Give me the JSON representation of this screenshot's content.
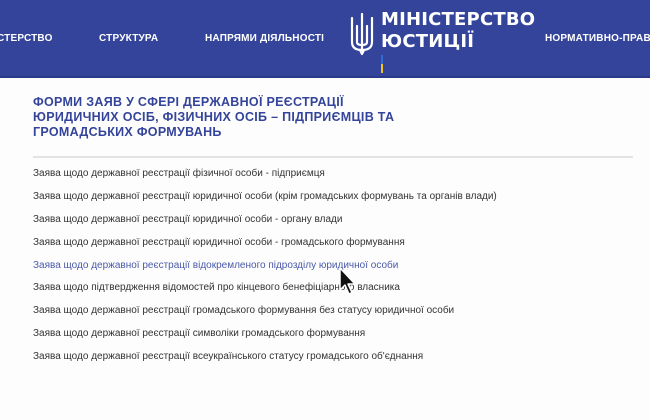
{
  "header": {
    "nav": [
      {
        "label": "ІСТЕРСТВО"
      },
      {
        "label": "СТРУКТУРА"
      },
      {
        "label": "НАПРЯМИ ДІЯЛЬНОСТІ"
      },
      {
        "label": "НОРМАТИВНО-ПРАВОВ"
      }
    ],
    "logo": {
      "line1": "МІНІСТЕРСТВО",
      "line2": "ЮСТИЦІЇ"
    }
  },
  "main": {
    "title": "ФОРМИ ЗАЯВ У СФЕРІ ДЕРЖАВНОЇ РЕЄСТРАЦІЇ ЮРИДИЧНИХ ОСІБ, ФІЗИЧНИХ ОСІБ – ПІДПРИЄМЦІВ ТА ГРОМАДСЬКИХ ФОРМУВАНЬ",
    "links": [
      {
        "label": "Заява щодо державної реєстрації фізичної особи - підприємця"
      },
      {
        "label": "Заява щодо державної реєстрації юридичної особи (крім громадських формувань та органів влади)"
      },
      {
        "label": "Заява щодо державної реєстрації юридичної особи - органу влади"
      },
      {
        "label": "Заява щодо державної реєстрації юридичної особи - громадського формування"
      },
      {
        "label": "Заява щодо державної реєстрації відокремленого підрозділу юридичної особи"
      },
      {
        "label": "Заява щодо підтвердження відомостей про кінцевого бенефіціарного власника"
      },
      {
        "label": "Заява щодо державної реєстрації громадського формування без статусу юридичної особи"
      },
      {
        "label": "Заява щодо державної реєстрації символіки громадського формування"
      },
      {
        "label": "Заява щодо державної реєстрації всеукраїнського статусу громадського об'єднання"
      }
    ]
  },
  "colors": {
    "header_bg": "#33449a",
    "title": "#33449a",
    "link_text": "#333333",
    "link_hover": "#4a5aa8",
    "flag_blue": "#2f6bd8",
    "flag_yellow": "#f3c71a"
  },
  "icons": [
    "trident-icon",
    "mouse-cursor-icon"
  ]
}
